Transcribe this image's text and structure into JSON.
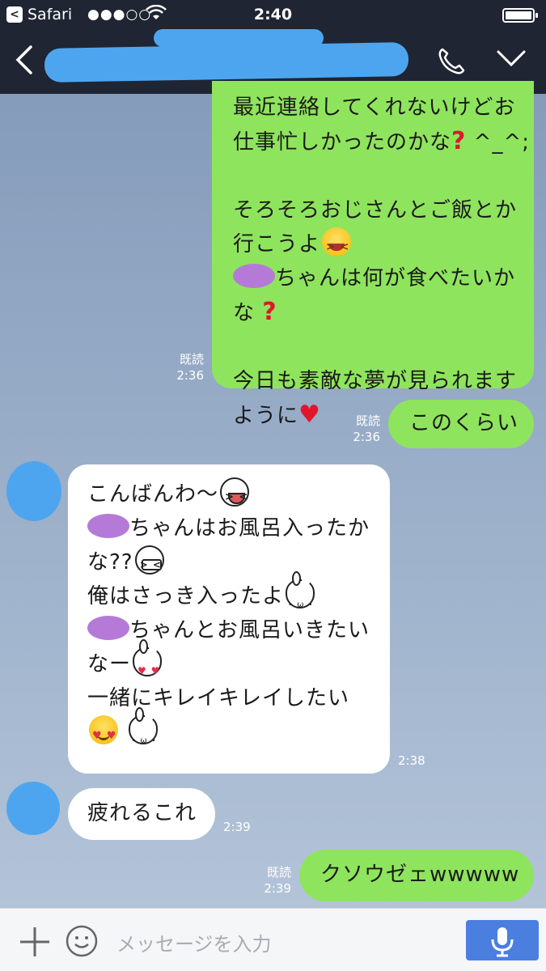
{
  "status_bar": {
    "app_back": "Safari",
    "signal": "●●●○○",
    "time": "2:40",
    "battery_level": 0.9
  },
  "nav": {
    "back_icon": "chevron-left-icon",
    "call_icon": "phone-icon",
    "menu_icon": "chevron-down-icon"
  },
  "messages": [
    {
      "side": "out",
      "read": "既読",
      "time": "2:36",
      "lines": [
        "最近連絡してくれないけどお",
        "仕事忙しかったのかな",
        "そろそろおじさんとご飯とか",
        "行こうよ",
        "ちゃんは何が食べたいか",
        "な",
        "今日も素敵な夢が見られます",
        "ように"
      ],
      "suffix": " ^_^;"
    },
    {
      "side": "out",
      "read": "既読",
      "time": "2:36",
      "text": "このくらい"
    },
    {
      "side": "in",
      "time": "2:38",
      "lines": [
        "こんばんわ〜",
        "ちゃんはお風呂入ったか",
        "な??",
        "俺はさっき入ったよ",
        "ちゃんとお風呂いきたい",
        "なー",
        "一緒にキレイキレイしたい"
      ]
    },
    {
      "side": "in",
      "time": "2:39",
      "text": "疲れるこれ"
    },
    {
      "side": "out",
      "read": "既読",
      "time": "2:39",
      "text": "クソウゼェwwwww"
    }
  ],
  "input": {
    "placeholder": "メッセージを入力"
  },
  "colors": {
    "bar": "#1f2532",
    "outgoing": "#8fe45d",
    "incoming": "#ffffff",
    "mic": "#4a7fe0"
  }
}
